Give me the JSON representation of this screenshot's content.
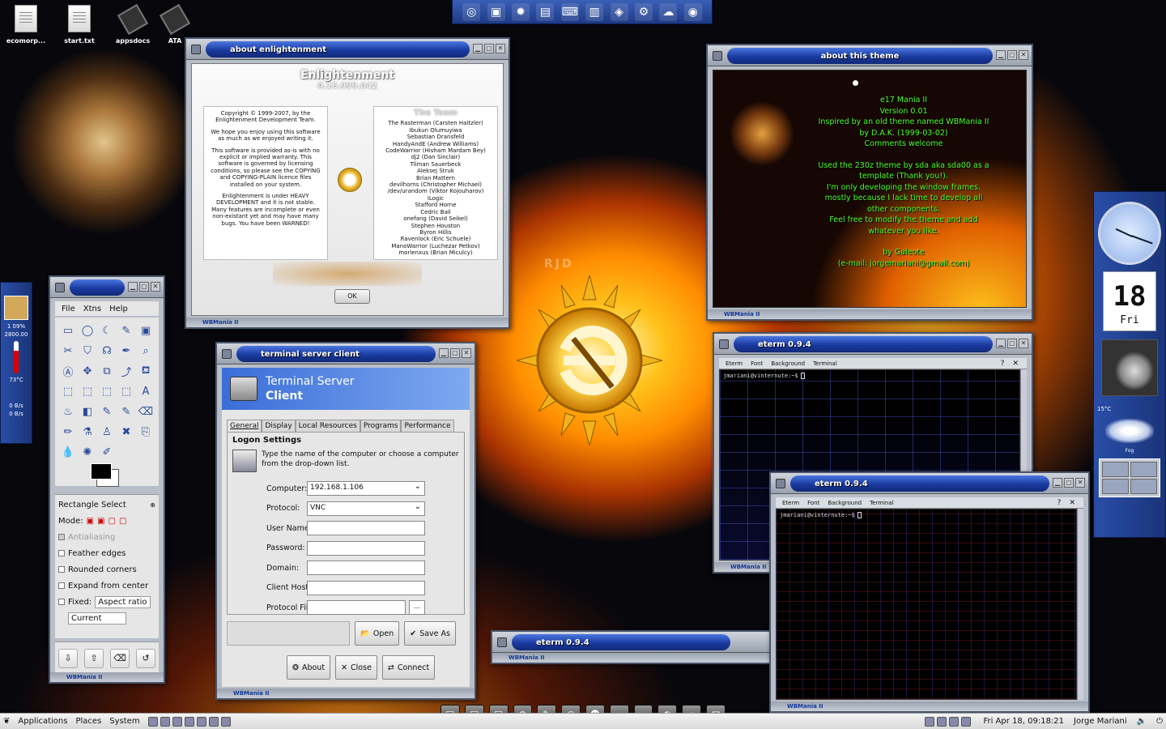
{
  "desktop_icons": [
    {
      "label": "ecomorp...",
      "icon": "text-file-icon"
    },
    {
      "label": "start.txt",
      "icon": "text-file-icon"
    },
    {
      "label": "appsdocs",
      "icon": "chip-icon"
    },
    {
      "label": "ATA",
      "icon": "chip-icon"
    }
  ],
  "launcher_icons": [
    "e17-icon",
    "terminal-icon",
    "browser-icon",
    "document-icon",
    "keyboard-icon",
    "window-icon",
    "package-icon",
    "settings-icon",
    "network-icon",
    "camera-icon"
  ],
  "about_e": {
    "title": "about enlightenment",
    "app_name": "Enlightenment",
    "version": "0.16.999.042",
    "left_paragraphs": [
      "Copyright © 1999-2007, by the Enlightenment Development Team.",
      "We hope you enjoy using this software as much as we enjoyed writing it.",
      "This software is provided as-is with no explicit or implied warranty. This software is governed by licensing conditions, so please see the COPYING and COPYING-PLAIN licence files installed on your system.",
      "Enlightenment is under HEAVY DEVELOPMENT and it is not stable. Many features are incomplete or even non-existant yet and may have many bugs. You have been WARNED!"
    ],
    "team_title": "The Team",
    "team": [
      "The Rasterman (Carsten Haitzler)",
      "Ibukun Olumuyiwa",
      "Sebastian Dransfeld",
      "HandyAndE (Andrew Williams)",
      "CodeWarrior (Hisham Mardam Bey)",
      "dj2 (Dan Sinclair)",
      "Tilman Sauerbeck",
      "Aleksej Struk",
      "Brian Mattern",
      "devilhorns (Christopher Michael)",
      "/dev/urandom (Viktor Kojouharov)",
      "iLogic",
      "Stafford Horne",
      "Cedric Bail",
      "onefang (David Seikel)",
      "Stephen Houston",
      "Byron Hillis",
      "Ravenlock (Eric Schuele)",
      "ManoWarrior (Luchezar Petkov)",
      "morlenxus (Brian Miculcy)"
    ],
    "ok_label": "OK",
    "footer": "WBMania II"
  },
  "about_theme": {
    "title": "about this theme",
    "lines": [
      "e17 Mania II",
      "Version 0.01",
      "Inspired by an old theme named WBMania II",
      "by D.A.K. (1999-03-02)",
      "Comments welcome",
      "",
      "Used the 230z theme by sda aka sda00 as a",
      "template (Thank you!).",
      "I'm only developing the window frames,",
      "mostly because I lack time to develop all",
      "other components.",
      "Feel free to modify the theme and add",
      "whatever you like.",
      "",
      "by Galeote",
      "(e-mail: jorgemariani@gmail.com)"
    ],
    "footer": "WBMania II"
  },
  "eterm": {
    "title": "eterm 0.9.4",
    "menu": [
      "Eterm",
      "Font",
      "Background",
      "Terminal"
    ],
    "help": "?",
    "close": "✕",
    "prompt": "jmariani@vinternute:~$",
    "footer": "WBMania II"
  },
  "gimp": {
    "menu": [
      "File",
      "Xtns",
      "Help"
    ],
    "tools": [
      "▭",
      "◯",
      "☾",
      "✎",
      "▣",
      "✂",
      "⛉",
      "☊",
      "✒",
      "⌕",
      "Ⓐ",
      "✥",
      "⧉",
      "⤴",
      "⛾",
      "⬚",
      "⬚",
      "⬚",
      "⬚",
      "A",
      "♨",
      "◧",
      "✎",
      "✎",
      "⌫",
      "✏",
      "⚗",
      "♙",
      "✖",
      "⎘",
      "💧",
      "✺",
      "✐"
    ],
    "tool_options_title": "Rectangle Select",
    "mode_label": "Mode:",
    "antialiasing": "Antialiasing",
    "feather_edges": "Feather edges",
    "rounded_corners": "Rounded corners",
    "expand_from_center": "Expand from center",
    "fixed_label": "Fixed:",
    "fixed_value": "Aspect ratio",
    "current_value": "Current",
    "footer": "WBMania II"
  },
  "tsc": {
    "title": "terminal server client",
    "banner_line1": "Terminal Server",
    "banner_line2": "Client",
    "tabs": [
      "General",
      "Display",
      "Local Resources",
      "Programs",
      "Performance"
    ],
    "section": "Logon Settings",
    "description": "Type the name of the computer or choose a computer from the drop-down list.",
    "fields": [
      {
        "label": "Computer:",
        "value": "192.168.1.106",
        "combo": true
      },
      {
        "label": "Protocol:",
        "value": "VNC",
        "combo": true
      },
      {
        "label": "User Name:",
        "value": ""
      },
      {
        "label": "Password:",
        "value": ""
      },
      {
        "label": "Domain:",
        "value": ""
      },
      {
        "label": "Client Hostname:",
        "value": ""
      },
      {
        "label": "Protocol File:",
        "value": ""
      }
    ],
    "browse_label": "...",
    "open_label": "Open",
    "save_as_label": "Save As",
    "about_label": "About",
    "close_label": "Close",
    "connect_label": "Connect",
    "footer": "WBMania II"
  },
  "left_panel": {
    "lines": [
      "1 09%",
      "2800.00",
      "73°C",
      "0 B/s",
      "0 B/s"
    ]
  },
  "right_panel": {
    "day": "18",
    "weekday": "Fri",
    "temperature": "15°C",
    "condition": "Fog"
  },
  "watermark": "RJD",
  "bottom_bar": {
    "applications": "Applications",
    "places": "Places",
    "system": "System",
    "datetime": "Fri Apr 18, 09:18:21",
    "user": "Jorge Mariani"
  },
  "dock_icons": [
    "terminal-icon",
    "terminal-icon",
    "terminal-icon",
    "globe-icon",
    "pen-icon",
    "e17-icon",
    "cat-icon",
    "monitor-icon",
    "folder-icon",
    "firefox-icon",
    "blank-icon",
    "mail-icon"
  ],
  "colors": {
    "titlebar": "#1a3aa0",
    "theme_text": "#4cff2c",
    "panel_blue": "#2a4ea8"
  }
}
